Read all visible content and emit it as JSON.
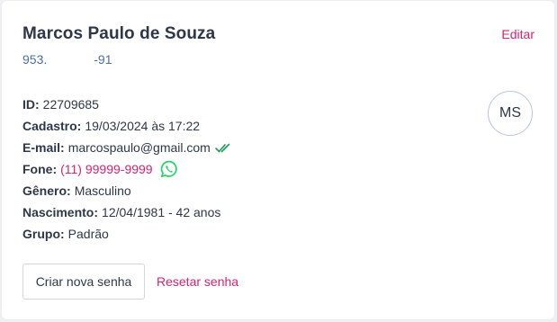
{
  "customer": {
    "name": "Marcos Paulo de Souza",
    "document_part1": "953.",
    "document_part2": "-91",
    "initials": "MS"
  },
  "header": {
    "edit_label": "Editar"
  },
  "details": {
    "id": {
      "label": "ID:",
      "value": "22709685"
    },
    "registered": {
      "label": "Cadastro:",
      "value": "19/03/2024 às 17:22"
    },
    "email": {
      "label": "E-mail:",
      "value": "marcospaulo@gmail.com",
      "verified_icon": "double-check-icon"
    },
    "phone": {
      "label": "Fone:",
      "value": "(11) 99999-9999",
      "icon": "whatsapp-icon"
    },
    "gender": {
      "label": "Gênero:",
      "value": "Masculino"
    },
    "birth": {
      "label": "Nascimento:",
      "value": "12/04/1981 - 42 anos"
    },
    "group": {
      "label": "Grupo:",
      "value": "Padrão"
    }
  },
  "actions": {
    "new_password_label": "Criar nova senha",
    "reset_password_label": "Resetar senha"
  },
  "colors": {
    "accent": "#d8226f",
    "text": "#2d3748",
    "secondary": "#4a6fa5",
    "verified": "#1f9a5c",
    "whatsapp": "#25d366"
  }
}
